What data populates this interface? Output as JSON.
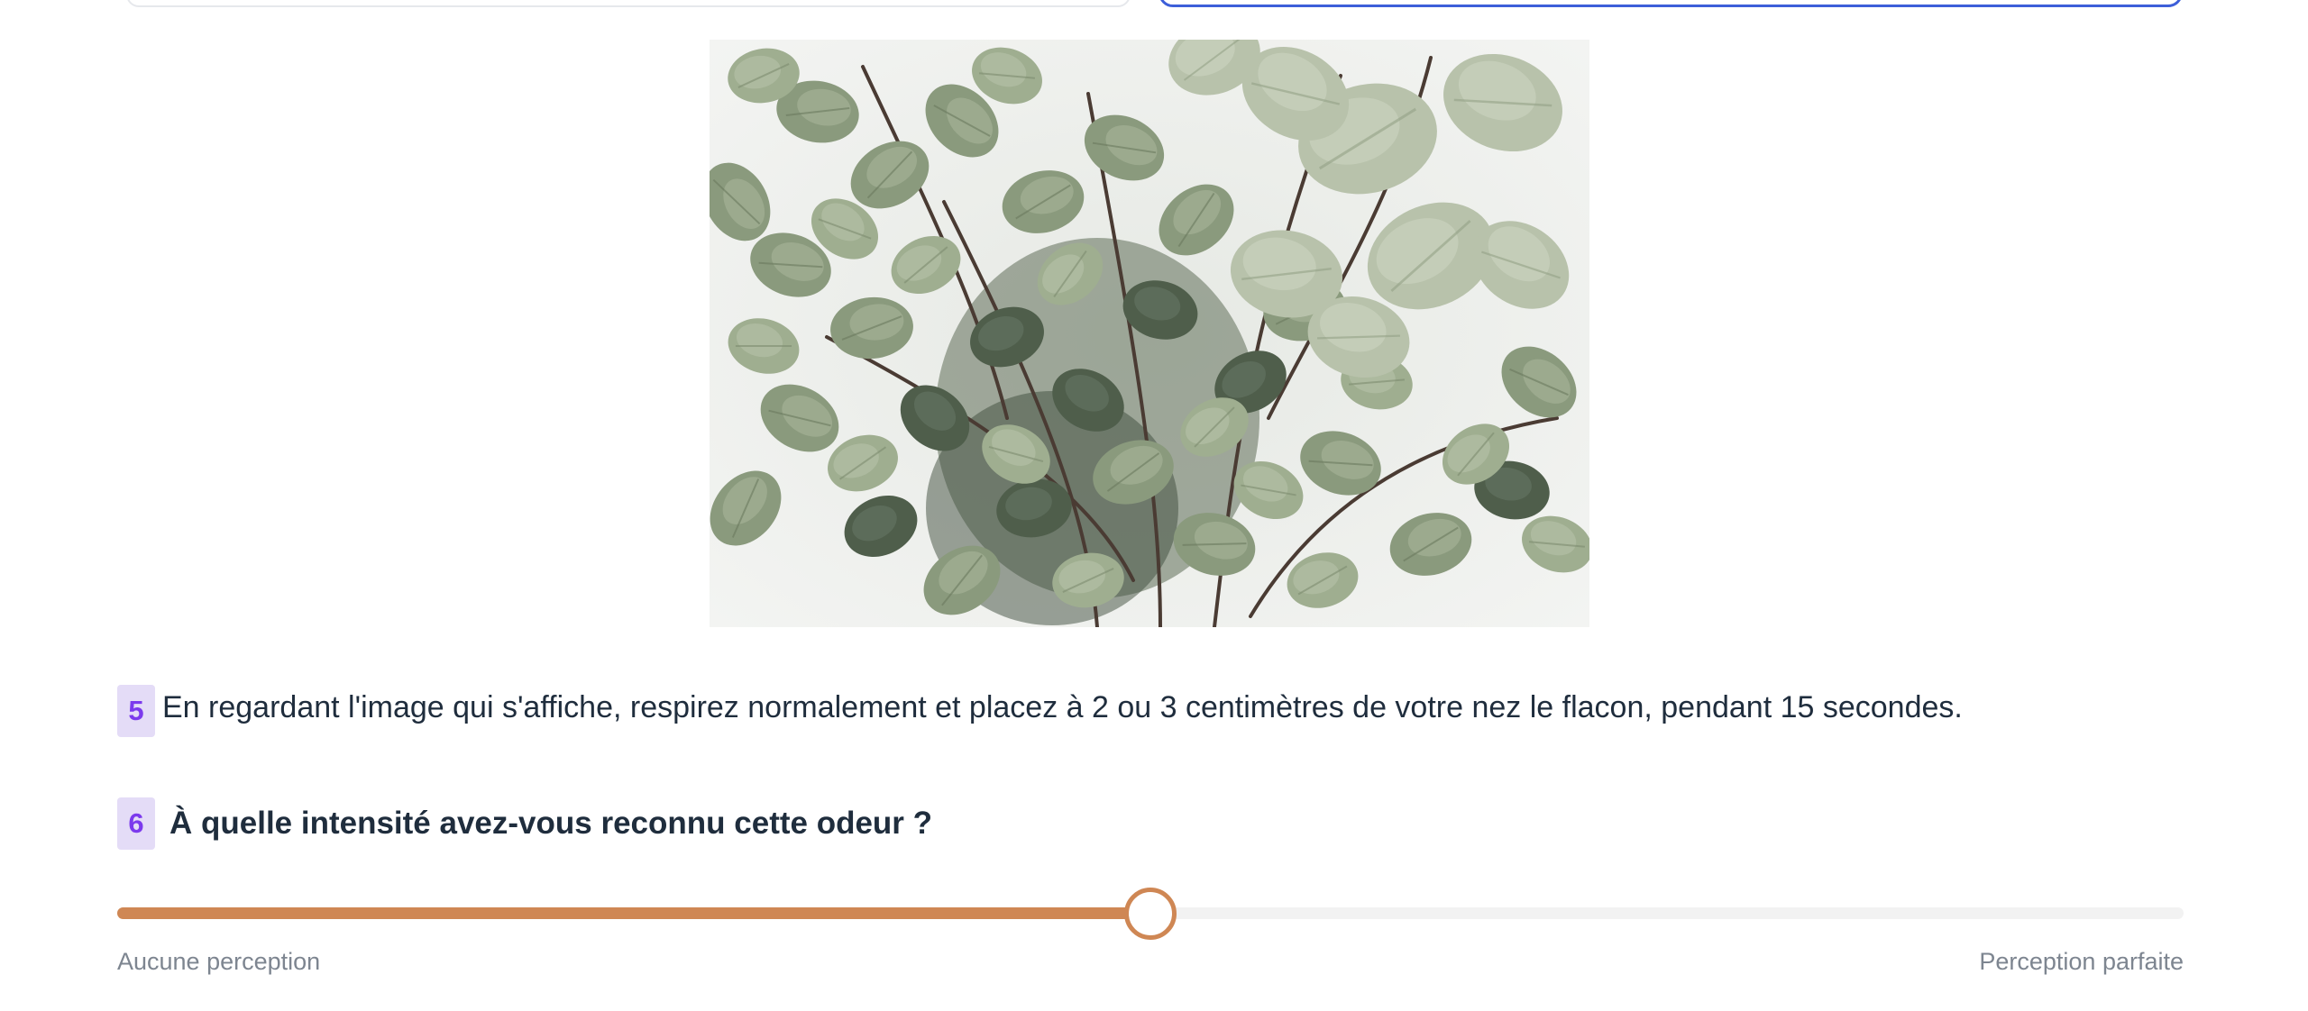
{
  "colors": {
    "accent_blue": "#3d5fd9",
    "badge_bg": "#e4dcf7",
    "badge_text": "#7c3aed",
    "slider_fill": "#cf8754",
    "slider_track": "#f2f2f2",
    "text": "#1f2d3d",
    "muted_text": "#7d8590"
  },
  "image": {
    "subject": "eucalyptus-leaves-photo"
  },
  "questions": [
    {
      "number": "5",
      "text": "En regardant l'image qui s'affiche, respirez normalement et placez à 2 ou 3 centimètres de votre nez le flacon, pendant 15 secondes."
    },
    {
      "number": "6",
      "text": "À quelle intensité avez-vous reconnu cette odeur ?"
    }
  ],
  "slider": {
    "value_fraction": 0.5,
    "min_label": "Aucune perception",
    "max_label": "Perception parfaite"
  }
}
